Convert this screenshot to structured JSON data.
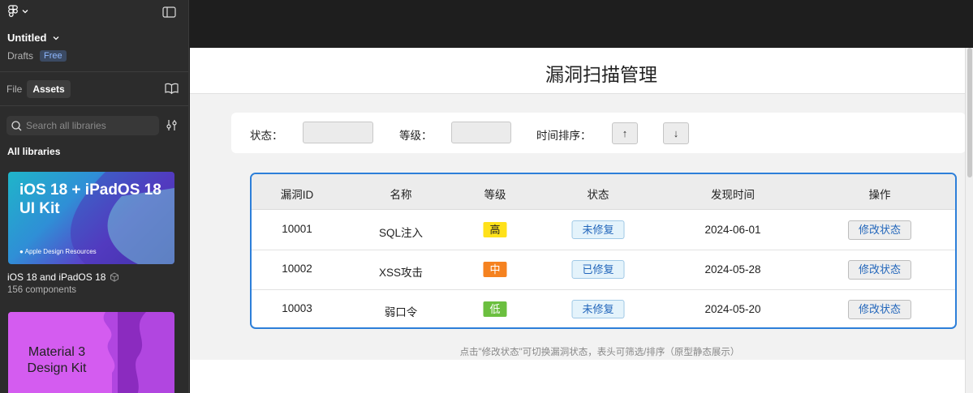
{
  "sidebar": {
    "file_title": "Untitled",
    "drafts": "Drafts",
    "plan_badge": "Free",
    "tabs": [
      {
        "label": "File"
      },
      {
        "label": "Assets"
      }
    ],
    "search_placeholder": "Search all libraries",
    "section_title": "All libraries",
    "libraries": [
      {
        "thumb_title": "iOS 18 + iPadOS 18 UI Kit",
        "thumb_sub": "Apple Design Resources",
        "name": "iOS 18 and iPadOS 18",
        "count": "156 components"
      },
      {
        "thumb_title": "Material 3 Design Kit"
      }
    ]
  },
  "page": {
    "title": "漏洞扫描管理",
    "filters": {
      "status_label": "状态：",
      "level_label": "等级：",
      "sort_label": "时间排序：",
      "sort_up": "↑",
      "sort_down": "↓"
    },
    "table": {
      "headers": [
        "漏洞ID",
        "名称",
        "等级",
        "状态",
        "发现时间",
        "操作"
      ],
      "rows": [
        {
          "id": "10001",
          "name": "SQL注入",
          "level": "高",
          "status": "未修复",
          "date": "2024-06-01",
          "action": "修改状态"
        },
        {
          "id": "10002",
          "name": "XSS攻击",
          "level": "中",
          "status": "已修复",
          "date": "2024-05-28",
          "action": "修改状态"
        },
        {
          "id": "10003",
          "name": "弱口令",
          "level": "低",
          "status": "未修复",
          "date": "2024-05-20",
          "action": "修改状态"
        }
      ]
    },
    "footnote": "点击\"修改状态\"可切换漏洞状态，表头可筛选/排序（原型静态展示）"
  },
  "colors": {
    "table_border": "#2d7fd9",
    "level_high": "#ffe11a",
    "level_mid": "#f58220",
    "level_low": "#6bbf3f",
    "badge_free": "#3b4a63"
  }
}
